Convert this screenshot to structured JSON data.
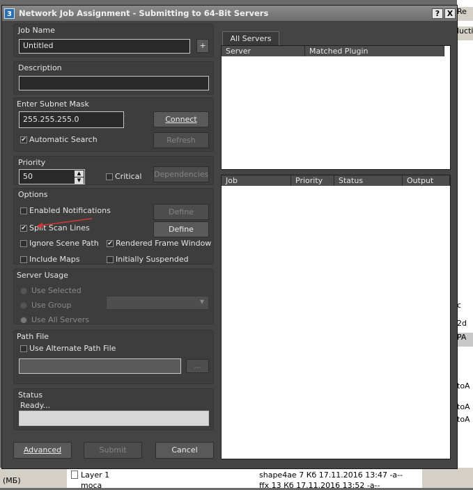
{
  "window": {
    "title": "Network Job Assignment - Submitting to 64-Bit Servers",
    "app_icon": "3",
    "help_label": "?",
    "close_label": "X"
  },
  "job_name": {
    "label": "Job Name",
    "value": "Untitled",
    "add_label": "+"
  },
  "description": {
    "label": "Description",
    "value": ""
  },
  "subnet": {
    "label": "Enter Subnet Mask",
    "value": "255.255.255.0",
    "connect_label": "Connect",
    "refresh_label": "Refresh",
    "auto_search_label": "Automatic Search",
    "auto_search_checked": true
  },
  "priority": {
    "label": "Priority",
    "value": "50",
    "critical_label": "Critical",
    "critical_checked": false,
    "dependencies_label": "Dependencies"
  },
  "options": {
    "label": "Options",
    "enabled_notifications": "Enabled Notifications",
    "define1_label": "Define",
    "split_scan_lines": "Split Scan Lines",
    "define2_label": "Define",
    "ignore_scene_path": "Ignore Scene Path",
    "rendered_frame_window": "Rendered Frame Window",
    "include_maps": "Include Maps",
    "initially_suspended": "Initially Suspended"
  },
  "server_usage": {
    "label": "Server Usage",
    "use_selected": "Use Selected",
    "use_group": "Use Group",
    "use_all_servers": "Use All Servers"
  },
  "path_file": {
    "label": "Path File",
    "use_alternate": "Use Alternate Path File",
    "browse_label": "..."
  },
  "status": {
    "label": "Status",
    "text": "Ready..."
  },
  "buttons": {
    "advanced": "Advanced",
    "submit": "Submit",
    "cancel": "Cancel"
  },
  "servers_panel": {
    "tab": "All Servers",
    "columns": [
      "Server",
      "Matched Plugin"
    ]
  },
  "jobs_panel": {
    "columns": [
      "Job",
      "Priority",
      "Status",
      "Output"
    ]
  },
  "background": {
    "top_right": "Re",
    "strip2": "luctio",
    "strip3": "c",
    "strip4": "2d",
    "strip5": "PA",
    "strip6": "toA",
    "strip7": "toA",
    "strip8": "toA",
    "taskbar_left": "(МБ)",
    "file1_name": "Layer 1",
    "file1_info": "shape4ae 7 Кб  17.11.2016 13:47 -a--",
    "file2_name": "moca",
    "file2_info": "ffx        13 Кб  17.11.2016 13:52 -a--"
  },
  "colors": {
    "dialog_bg": "#444444",
    "group_bg": "#3d3d3d",
    "annotation_arrow": "#d23a3a"
  }
}
